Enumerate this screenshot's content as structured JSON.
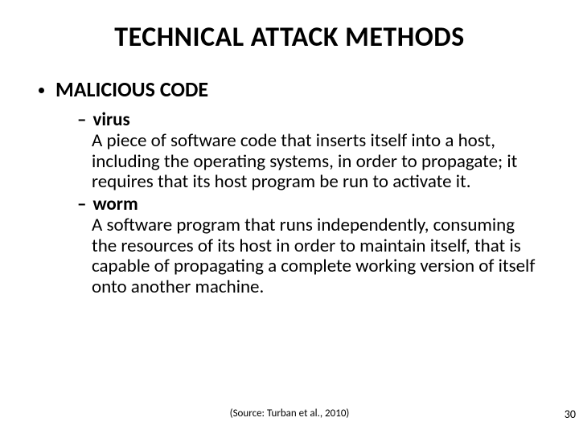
{
  "title": "TECHNICAL ATTACK METHODS",
  "heading": "MALICIOUS CODE",
  "items": [
    {
      "term": "virus",
      "definition": "A piece of software code that inserts itself into a host, including the operating systems, in order to propagate; it requires that its host program be run to activate it."
    },
    {
      "term": "worm",
      "definition": "A software program that runs independently, consuming the resources of its host in order to maintain itself, that is capable of propagating a complete working version of itself onto another machine."
    }
  ],
  "source": "(Source: Turban et al., 2010)",
  "page": "30"
}
